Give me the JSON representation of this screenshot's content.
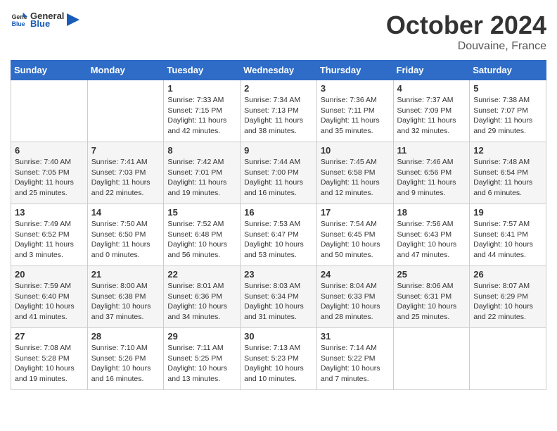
{
  "header": {
    "logo": {
      "general": "General",
      "blue": "Blue",
      "tagline": "GeneralBlue"
    },
    "title": "October 2024",
    "location": "Douvaine, France"
  },
  "weekdays": [
    "Sunday",
    "Monday",
    "Tuesday",
    "Wednesday",
    "Thursday",
    "Friday",
    "Saturday"
  ],
  "weeks": [
    [
      {
        "day": null,
        "info": null
      },
      {
        "day": null,
        "info": null
      },
      {
        "day": "1",
        "info": "Sunrise: 7:33 AM\nSunset: 7:15 PM\nDaylight: 11 hours and 42 minutes."
      },
      {
        "day": "2",
        "info": "Sunrise: 7:34 AM\nSunset: 7:13 PM\nDaylight: 11 hours and 38 minutes."
      },
      {
        "day": "3",
        "info": "Sunrise: 7:36 AM\nSunset: 7:11 PM\nDaylight: 11 hours and 35 minutes."
      },
      {
        "day": "4",
        "info": "Sunrise: 7:37 AM\nSunset: 7:09 PM\nDaylight: 11 hours and 32 minutes."
      },
      {
        "day": "5",
        "info": "Sunrise: 7:38 AM\nSunset: 7:07 PM\nDaylight: 11 hours and 29 minutes."
      }
    ],
    [
      {
        "day": "6",
        "info": "Sunrise: 7:40 AM\nSunset: 7:05 PM\nDaylight: 11 hours and 25 minutes."
      },
      {
        "day": "7",
        "info": "Sunrise: 7:41 AM\nSunset: 7:03 PM\nDaylight: 11 hours and 22 minutes."
      },
      {
        "day": "8",
        "info": "Sunrise: 7:42 AM\nSunset: 7:01 PM\nDaylight: 11 hours and 19 minutes."
      },
      {
        "day": "9",
        "info": "Sunrise: 7:44 AM\nSunset: 7:00 PM\nDaylight: 11 hours and 16 minutes."
      },
      {
        "day": "10",
        "info": "Sunrise: 7:45 AM\nSunset: 6:58 PM\nDaylight: 11 hours and 12 minutes."
      },
      {
        "day": "11",
        "info": "Sunrise: 7:46 AM\nSunset: 6:56 PM\nDaylight: 11 hours and 9 minutes."
      },
      {
        "day": "12",
        "info": "Sunrise: 7:48 AM\nSunset: 6:54 PM\nDaylight: 11 hours and 6 minutes."
      }
    ],
    [
      {
        "day": "13",
        "info": "Sunrise: 7:49 AM\nSunset: 6:52 PM\nDaylight: 11 hours and 3 minutes."
      },
      {
        "day": "14",
        "info": "Sunrise: 7:50 AM\nSunset: 6:50 PM\nDaylight: 11 hours and 0 minutes."
      },
      {
        "day": "15",
        "info": "Sunrise: 7:52 AM\nSunset: 6:48 PM\nDaylight: 10 hours and 56 minutes."
      },
      {
        "day": "16",
        "info": "Sunrise: 7:53 AM\nSunset: 6:47 PM\nDaylight: 10 hours and 53 minutes."
      },
      {
        "day": "17",
        "info": "Sunrise: 7:54 AM\nSunset: 6:45 PM\nDaylight: 10 hours and 50 minutes."
      },
      {
        "day": "18",
        "info": "Sunrise: 7:56 AM\nSunset: 6:43 PM\nDaylight: 10 hours and 47 minutes."
      },
      {
        "day": "19",
        "info": "Sunrise: 7:57 AM\nSunset: 6:41 PM\nDaylight: 10 hours and 44 minutes."
      }
    ],
    [
      {
        "day": "20",
        "info": "Sunrise: 7:59 AM\nSunset: 6:40 PM\nDaylight: 10 hours and 41 minutes."
      },
      {
        "day": "21",
        "info": "Sunrise: 8:00 AM\nSunset: 6:38 PM\nDaylight: 10 hours and 37 minutes."
      },
      {
        "day": "22",
        "info": "Sunrise: 8:01 AM\nSunset: 6:36 PM\nDaylight: 10 hours and 34 minutes."
      },
      {
        "day": "23",
        "info": "Sunrise: 8:03 AM\nSunset: 6:34 PM\nDaylight: 10 hours and 31 minutes."
      },
      {
        "day": "24",
        "info": "Sunrise: 8:04 AM\nSunset: 6:33 PM\nDaylight: 10 hours and 28 minutes."
      },
      {
        "day": "25",
        "info": "Sunrise: 8:06 AM\nSunset: 6:31 PM\nDaylight: 10 hours and 25 minutes."
      },
      {
        "day": "26",
        "info": "Sunrise: 8:07 AM\nSunset: 6:29 PM\nDaylight: 10 hours and 22 minutes."
      }
    ],
    [
      {
        "day": "27",
        "info": "Sunrise: 7:08 AM\nSunset: 5:28 PM\nDaylight: 10 hours and 19 minutes."
      },
      {
        "day": "28",
        "info": "Sunrise: 7:10 AM\nSunset: 5:26 PM\nDaylight: 10 hours and 16 minutes."
      },
      {
        "day": "29",
        "info": "Sunrise: 7:11 AM\nSunset: 5:25 PM\nDaylight: 10 hours and 13 minutes."
      },
      {
        "day": "30",
        "info": "Sunrise: 7:13 AM\nSunset: 5:23 PM\nDaylight: 10 hours and 10 minutes."
      },
      {
        "day": "31",
        "info": "Sunrise: 7:14 AM\nSunset: 5:22 PM\nDaylight: 10 hours and 7 minutes."
      },
      {
        "day": null,
        "info": null
      },
      {
        "day": null,
        "info": null
      }
    ]
  ]
}
